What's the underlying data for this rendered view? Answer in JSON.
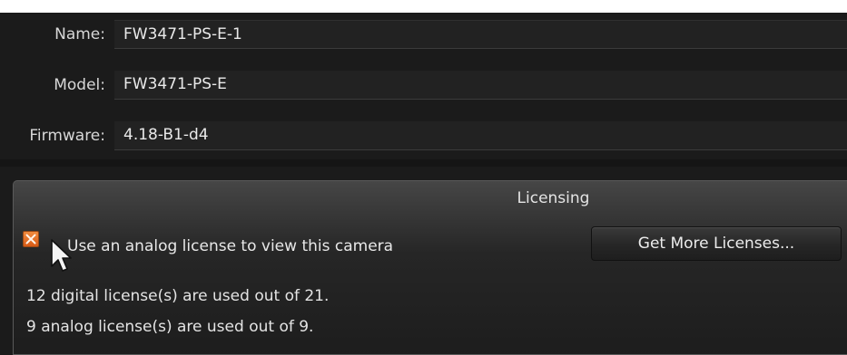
{
  "device": {
    "name_label": "Name:",
    "name_value": "FW3471-PS-E-1",
    "model_label": "Model:",
    "model_value": "FW3471-PS-E",
    "firmware_label": "Firmware:",
    "firmware_value": "4.18-B1-d4"
  },
  "licensing": {
    "title": "Licensing",
    "analog_checkbox_label": "Use an analog license to view this camera",
    "analog_checkbox_checked": true,
    "get_more_button": "Get More Licenses...",
    "digital_status": "12 digital license(s) are used out of 21.",
    "analog_status": "9 analog license(s) are used out of 9."
  },
  "colors": {
    "background": "#1b1b1b",
    "checkbox_accent": "#e86a22"
  },
  "icons": {
    "checkbox_mark": "x-mark-icon",
    "cursor": "mouse-pointer-icon"
  }
}
